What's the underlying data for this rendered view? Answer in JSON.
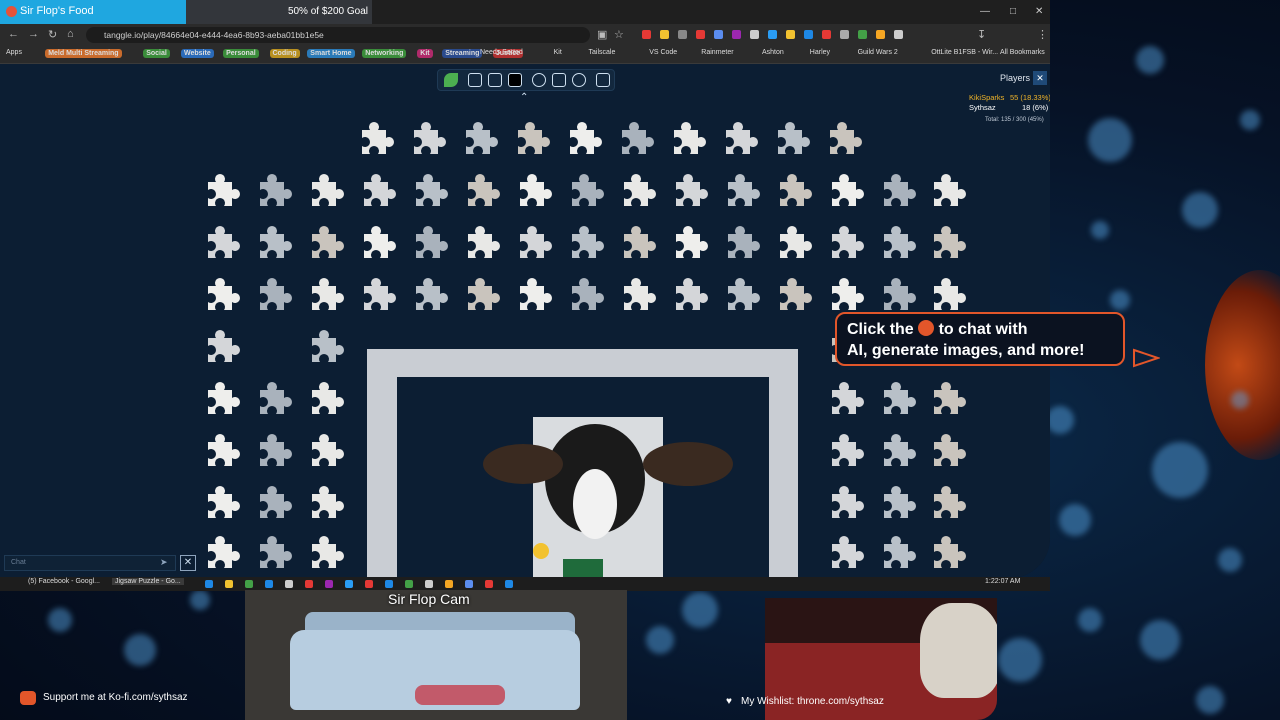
{
  "browser": {
    "tab_title": "Sir Flop's Food",
    "goal_text": "50% of $200 Goal",
    "goal_progress": 0.5,
    "url": "tanggle.io/play/84664e04-e444-4ea6-8b93-aeba01bb1e5e"
  },
  "bookmarks": [
    {
      "label": "Apps"
    },
    {
      "label": "Meld Multi Streaming",
      "color": "#c96b2c"
    },
    {
      "label": "Social",
      "color": "#3a8c3a"
    },
    {
      "label": "Website",
      "color": "#2a6ab8"
    },
    {
      "label": "Personal",
      "color": "#3a8c3a"
    },
    {
      "label": "Coding",
      "color": "#b89020"
    },
    {
      "label": "Smart Home",
      "color": "#2a7ab8"
    },
    {
      "label": "Networking",
      "color": "#3a8c3a"
    },
    {
      "label": "Kit",
      "color": "#b02a6a"
    },
    {
      "label": "Streaming",
      "color": "#2a4a8c"
    },
    {
      "label": "Justice",
      "color": "#b03030"
    },
    {
      "label": "Needs Sorted"
    },
    {
      "label": "Kit"
    },
    {
      "label": "Tailscale"
    },
    {
      "label": "VS Code"
    },
    {
      "label": "Rainmeter"
    },
    {
      "label": "Ashton"
    },
    {
      "label": "Harley"
    },
    {
      "label": "Guild Wars 2"
    },
    {
      "label": "OttLite B1FSB - Wir..."
    },
    {
      "label": "All Bookmarks"
    }
  ],
  "players_panel": {
    "title": "Players",
    "players": [
      {
        "name": "KikiSparks",
        "score": "55 (18.33%)",
        "color": "#f0b429"
      },
      {
        "name": "Sythsaz",
        "score": "18 (6%)",
        "color": "#ffffff"
      }
    ],
    "total": "Total: 135 / 300 (45%)"
  },
  "chat": {
    "placeholder": "Chat"
  },
  "callout": {
    "line1_a": "Click the",
    "line1_b": "to chat with",
    "line2": "AI, generate images, and more!"
  },
  "taskbar": {
    "items": [
      "(5) Facebook - Googl...",
      "Jigsaw Puzzle - Go..."
    ],
    "clock": "1:22:07 AM"
  },
  "overlay": {
    "cam_label": "Sir Flop Cam",
    "kofi_text": "Support me at Ko-fi.com/sythsaz",
    "wishlist_text": "My Wishlist: throne.com/sythsaz"
  },
  "colors": {
    "accent": "#e2562a",
    "goal_bar": "#1fa7e0",
    "page_bg": "#0c1e33"
  }
}
